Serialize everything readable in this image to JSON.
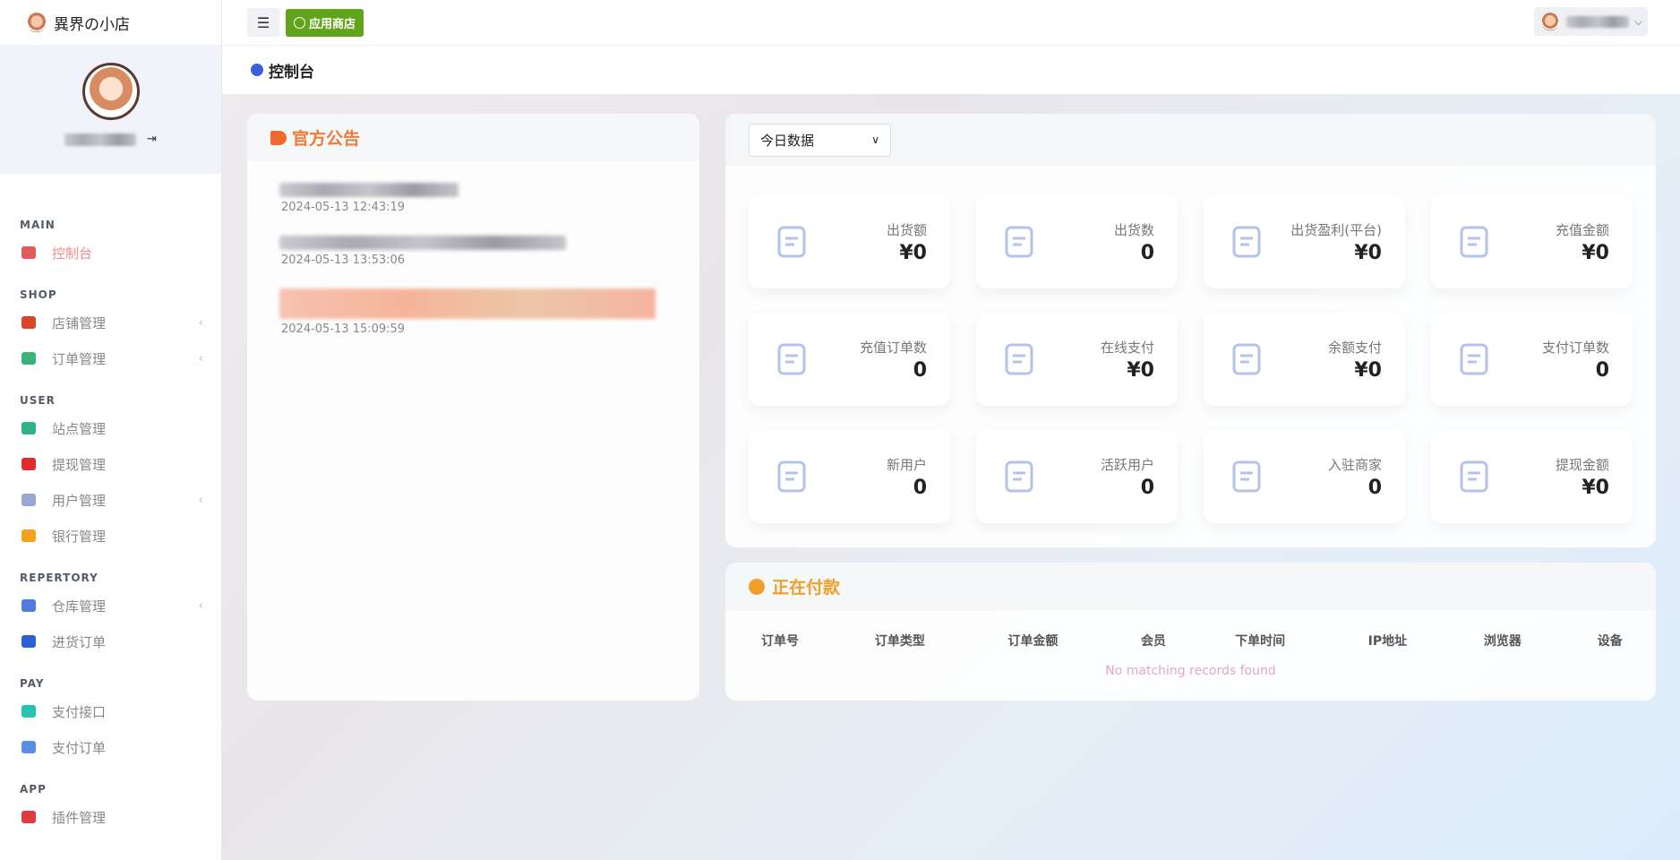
{
  "brand": {
    "name": "異界の小店"
  },
  "topbar": {
    "store_label": "应用商店",
    "menu_icon": "☰"
  },
  "breadcrumb": {
    "title": "控制台"
  },
  "sidebar": {
    "sections": [
      {
        "title": "MAIN",
        "items": [
          {
            "label": "控制台",
            "active": true,
            "color": "#e25b5b"
          }
        ]
      },
      {
        "title": "SHOP",
        "items": [
          {
            "label": "店铺管理",
            "sub": true,
            "color": "#d9442b"
          },
          {
            "label": "订单管理",
            "sub": true,
            "color": "#3bb27a"
          }
        ]
      },
      {
        "title": "USER",
        "items": [
          {
            "label": "站点管理",
            "color": "#2fb38a"
          },
          {
            "label": "提现管理",
            "color": "#e02b2b"
          },
          {
            "label": "用户管理",
            "sub": true,
            "color": "#9aa7d6"
          },
          {
            "label": "银行管理",
            "color": "#f2a21b"
          }
        ]
      },
      {
        "title": "REPERTORY",
        "items": [
          {
            "label": "仓库管理",
            "sub": true,
            "color": "#4d7be0"
          },
          {
            "label": "进货订单",
            "color": "#2e5fd9"
          }
        ]
      },
      {
        "title": "PAY",
        "items": [
          {
            "label": "支付接口",
            "color": "#24c4b4"
          },
          {
            "label": "支付订单",
            "color": "#5a8ee6"
          }
        ]
      },
      {
        "title": "APP",
        "items": [
          {
            "label": "插件管理",
            "color": "#e03a3a"
          }
        ]
      }
    ]
  },
  "announcement": {
    "title": "官方公告",
    "items": [
      {
        "date": "2024-05-13 12:43:19"
      },
      {
        "date": "2024-05-13 13:53:06"
      },
      {
        "date": "2024-05-13 15:09:59"
      }
    ]
  },
  "stats": {
    "range": "今日数据",
    "cards": [
      {
        "label": "出货额",
        "value": "¥0",
        "icon": "box-check"
      },
      {
        "label": "出货数",
        "value": "0",
        "icon": "document"
      },
      {
        "label": "出货盈利(平台)",
        "value": "¥0",
        "icon": "dollar-refresh"
      },
      {
        "label": "充值金额",
        "value": "¥0",
        "icon": "card"
      },
      {
        "label": "充值订单数",
        "value": "0",
        "icon": "invoice-yen"
      },
      {
        "label": "在线支付",
        "value": "¥0",
        "icon": "monitor-yen"
      },
      {
        "label": "余额支付",
        "value": "¥0",
        "icon": "yen-coin"
      },
      {
        "label": "支付订单数",
        "value": "0",
        "icon": "wallet-check"
      },
      {
        "label": "新用户",
        "value": "0",
        "icon": "user-plus"
      },
      {
        "label": "活跃用户",
        "value": "0",
        "icon": "user-activity"
      },
      {
        "label": "入驻商家",
        "value": "0",
        "icon": "shop-enter"
      },
      {
        "label": "提现金额",
        "value": "¥0",
        "icon": "money-bag"
      }
    ]
  },
  "payments": {
    "title": "正在付款",
    "columns": [
      "订单号",
      "订单类型",
      "订单金额",
      "会员",
      "下单时间",
      "IP地址",
      "浏览器",
      "设备"
    ],
    "empty": "No matching records found"
  }
}
